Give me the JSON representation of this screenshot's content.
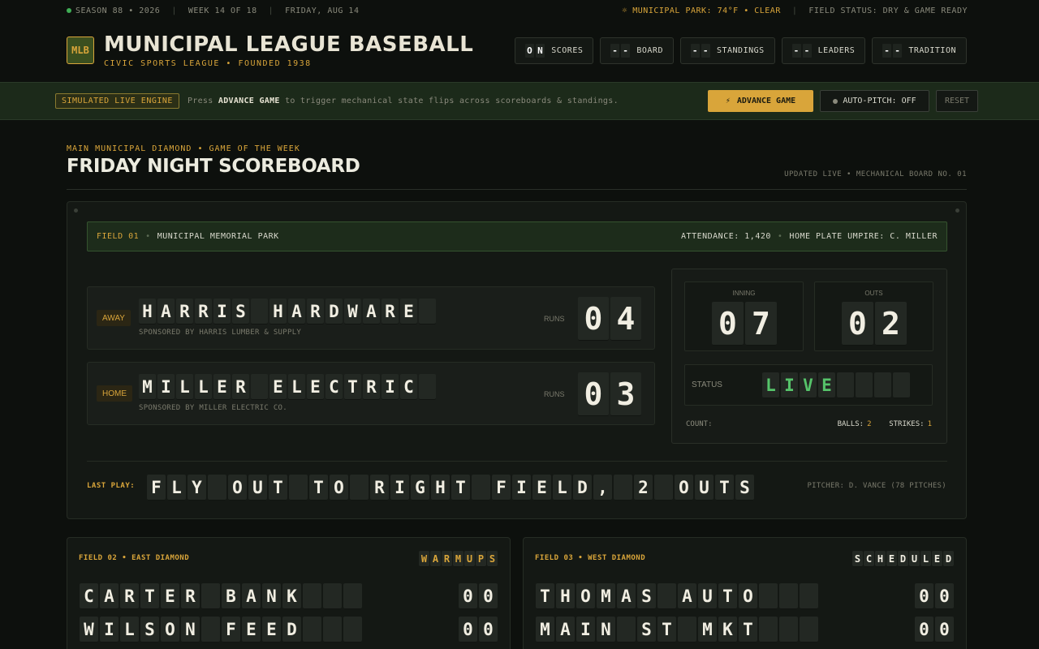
{
  "topbar": {
    "season": "SEASON 88 • 2026",
    "week": "WEEK 14 OF 18",
    "date": "FRIDAY, AUG 14",
    "weather": "MUNICIPAL PARK: 74°F • CLEAR",
    "field_status": "FIELD STATUS: DRY & GAME READY"
  },
  "header": {
    "logo": "MLB",
    "title": "MUNICIPAL LEAGUE BASEBALL",
    "subtitle": "CIVIC SPORTS LEAGUE • FOUNDED 1938",
    "nav": [
      {
        "tiles": [
          "O",
          "N"
        ],
        "label": "SCORES"
      },
      {
        "tiles": [
          "-",
          "-"
        ],
        "label": "BOARD"
      },
      {
        "tiles": [
          "-",
          "-"
        ],
        "label": "STANDINGS"
      },
      {
        "tiles": [
          "-",
          "-"
        ],
        "label": "LEADERS"
      },
      {
        "tiles": [
          "-",
          "-"
        ],
        "label": "TRADITION"
      }
    ]
  },
  "engine": {
    "tag": "SIMULATED LIVE ENGINE",
    "msg_pre": "Press",
    "msg_bold": "ADVANCE GAME",
    "msg_post": "to trigger mechanical state flips across scoreboards & standings.",
    "advance_label": "ADVANCE GAME",
    "auto_label": "AUTO-PITCH: OFF",
    "reset_label": "RESET"
  },
  "section": {
    "kicker": "MAIN MUNICIPAL DIAMOND • GAME OF THE WEEK",
    "title": "FRIDAY NIGHT SCOREBOARD",
    "meta": "UPDATED LIVE • MECHANICAL BOARD NO. 01"
  },
  "board": {
    "field_no": "FIELD 01",
    "field_name": "MUNICIPAL MEMORIAL PARK",
    "attendance": "ATTENDANCE: 1,420",
    "umpire": "HOME PLATE UMPIRE: C. MILLER",
    "away": {
      "badge": "AWAY",
      "name": "HARRIS HARDWARE ",
      "sponsor": "SPONSORED BY HARRIS LUMBER & SUPPLY",
      "runs_label": "RUNS",
      "runs": "04"
    },
    "home": {
      "badge": "HOME",
      "name": "MILLER ELECTRIC ",
      "sponsor": "SPONSORED BY MILLER ELECTRIC CO.",
      "runs_label": "RUNS",
      "runs": "03"
    },
    "inning_label": "INNING",
    "inning": "07",
    "outs_label": "OUTS",
    "outs": "02",
    "status_label": "STATUS",
    "status": "LIVE    ",
    "count_label": "COUNT:",
    "balls_label": "BALLS:",
    "balls": "2",
    "strikes_label": "STRIKES:",
    "strikes": "1",
    "last_play_label": "LAST PLAY:",
    "last_play": "FLY OUT TO RIGHT FIELD, 2 OUTS",
    "pitcher": "PITCHER: D. VANCE (78 PITCHES)"
  },
  "minis": [
    {
      "header": "FIELD 02 • EAST DIAMOND",
      "badge": "WARMUPS",
      "rows": [
        {
          "name": "CARTER BANK   ",
          "score": "00"
        },
        {
          "name": "WILSON FEED   ",
          "score": "00"
        }
      ]
    },
    {
      "header": "FIELD 03 • WEST DIAMOND",
      "badge": "SCHEDULED",
      "rows": [
        {
          "name": "THOMAS AUTO   ",
          "score": "00"
        },
        {
          "name": "MAIN ST MKT   ",
          "score": "00"
        }
      ]
    }
  ]
}
